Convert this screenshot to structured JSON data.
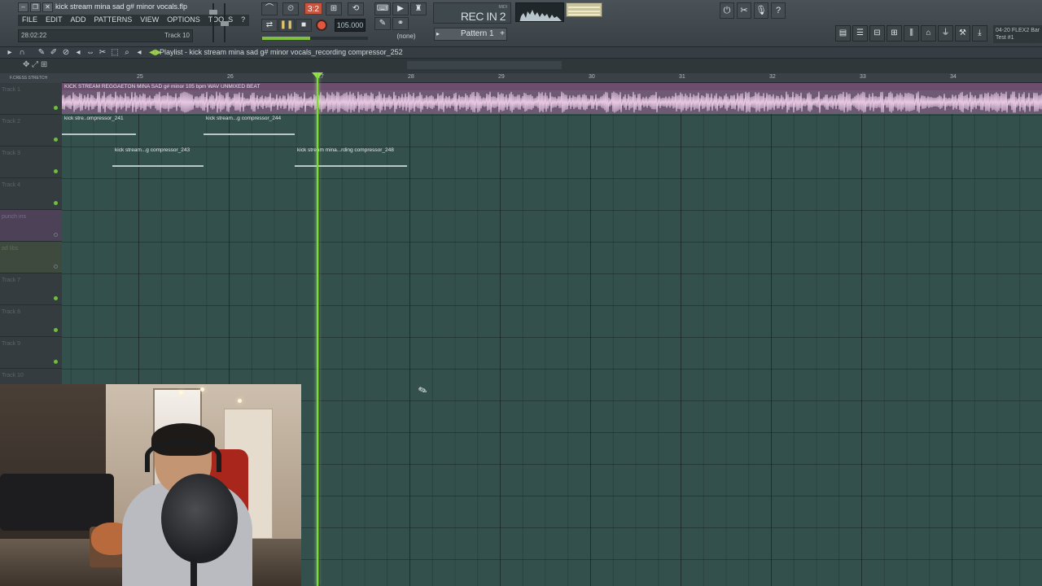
{
  "app": {
    "file_title": "kick stream mina sad g# minor vocals.flp",
    "menu": [
      "FILE",
      "EDIT",
      "ADD",
      "PATTERNS",
      "VIEW",
      "OPTIONS",
      "TOOLS",
      "?"
    ],
    "hint_time": "28:02:22",
    "hint_track": "Track 10"
  },
  "transport": {
    "time_sig": "3:2",
    "tempo": "105.000",
    "play_glyph": "❚❚",
    "stop_glyph": "■",
    "snap": "(none)",
    "song_position_fraction": 0.45
  },
  "recording": {
    "midi_label": "MIDI",
    "label": "REC IN 2"
  },
  "pattern": {
    "label": "Pattern 1",
    "prev_glyph": "▸",
    "add_glyph": "+"
  },
  "news": {
    "line1": "04-20  FLEX2 Bar",
    "line2": "Test #1"
  },
  "playlist": {
    "title": "Playlist - kick stream mina sad g# minor vocals_recording compressor_252",
    "header_controls": "F.CRESS   STRETCH",
    "bars": [
      "25",
      "26",
      "27",
      "28",
      "29",
      "30",
      "31",
      "32",
      "33",
      "34"
    ],
    "tracks": [
      {
        "name": "Track 1",
        "style": "normal"
      },
      {
        "name": "Track 2",
        "style": "normal"
      },
      {
        "name": "Track 3",
        "style": "normal"
      },
      {
        "name": "Track 4",
        "style": "normal"
      },
      {
        "name": "punch ins",
        "style": "purple"
      },
      {
        "name": "ad libs",
        "style": "green"
      },
      {
        "name": "Track 7",
        "style": "normal"
      },
      {
        "name": "Track 8",
        "style": "normal"
      },
      {
        "name": "Track 9",
        "style": "normal"
      },
      {
        "name": "Track 10",
        "style": "normal"
      }
    ],
    "clips": {
      "beat": "KICK STREAM REGGAETON MINA SAD g# minor 105 bpm WAV UNMIXED BEAT",
      "t2a": "kick stre..ompressor_241",
      "t2b": "kick stream...g compressor_244",
      "t3a": "kick stream...g compressor_243",
      "t3b": "kick stream mina...rding compressor_248"
    }
  },
  "colors": {
    "grid": "#33504d",
    "playhead": "#7ddc35",
    "beat_clip": "#6f5a74",
    "record": "#e2563f"
  }
}
